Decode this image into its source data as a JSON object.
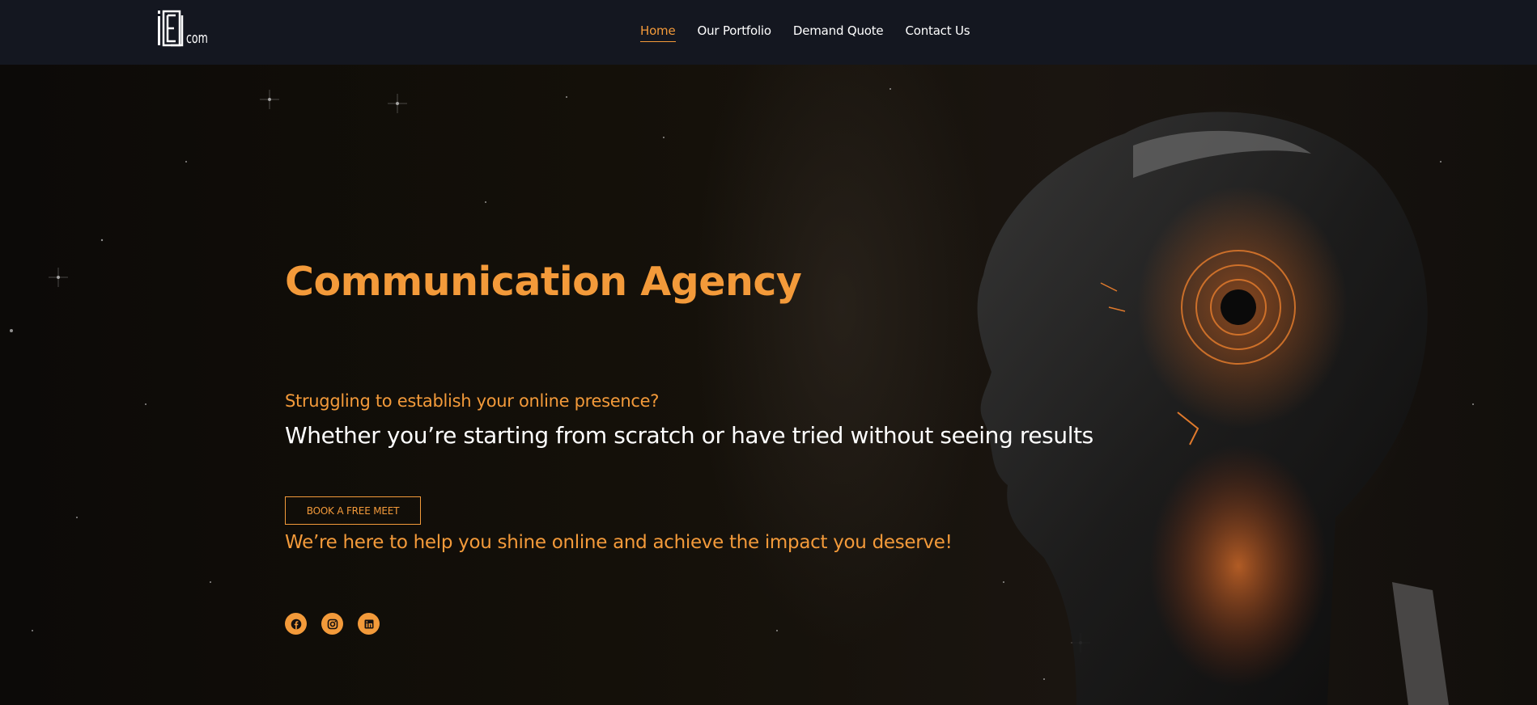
{
  "brand": {
    "logo_text": "iLEicom"
  },
  "nav": {
    "items": [
      {
        "label": "Home",
        "active": true
      },
      {
        "label": "Our Portfolio"
      },
      {
        "label": "Demand Quote"
      },
      {
        "label": "Contact Us"
      }
    ]
  },
  "hero": {
    "title": "Communication Agency",
    "subtitle": "Struggling to establish your online presence?",
    "tagline": "Whether you’re starting from scratch or have tried without seeing results",
    "cta_label": "BOOK A FREE MEET",
    "promise": "We’re here to help you shine online and achieve the impact you deserve!",
    "background_icon": "robot-head-illustration"
  },
  "social": [
    {
      "icon": "facebook-icon"
    },
    {
      "icon": "instagram-icon"
    },
    {
      "icon": "linkedin-icon"
    }
  ],
  "colors": {
    "accent": "#f39a3a",
    "nav_bg": "#141720",
    "text": "#ffffff"
  }
}
